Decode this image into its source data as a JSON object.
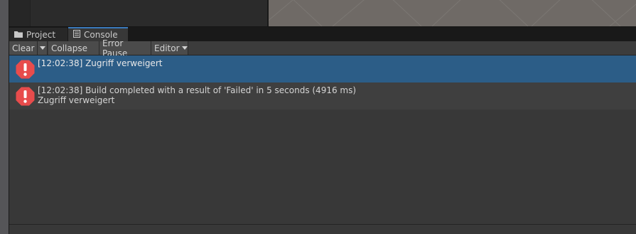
{
  "tabs": {
    "project_label": "Project",
    "console_label": "Console"
  },
  "toolbar": {
    "clear_label": "Clear",
    "collapse_label": "Collapse",
    "error_pause_label": "Error Pause",
    "editor_label": "Editor"
  },
  "console": {
    "entries": [
      {
        "line1": "[12:02:38] Zugriff verweigert",
        "line2": ""
      },
      {
        "line1": "[12:02:38] Build completed with a result of 'Failed' in 5 seconds (4916 ms)",
        "line2": "Zugriff verweigert"
      }
    ]
  },
  "colors": {
    "selected_row": "#2c5d87",
    "error_icon": "#e84c4c",
    "tab_accent": "#3a79bb",
    "scene_background": "#6f6a66"
  },
  "icons": {
    "project_tab": "folder-icon",
    "console_tab": "console-icon",
    "entry": "error-icon"
  }
}
